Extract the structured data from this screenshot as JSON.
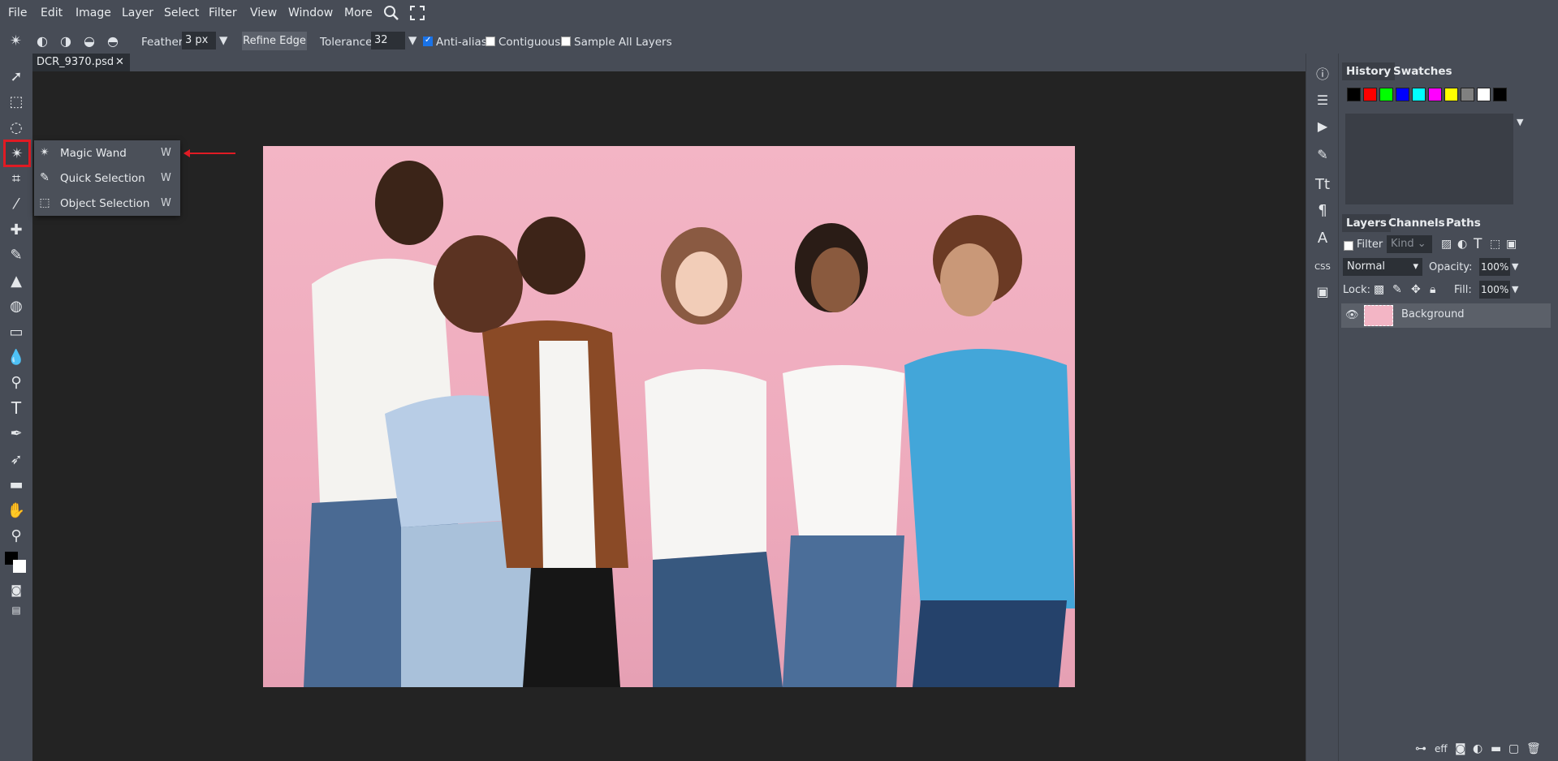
{
  "menu": {
    "items": [
      "File",
      "Edit",
      "Image",
      "Layer",
      "Select",
      "Filter",
      "View",
      "Window",
      "More"
    ]
  },
  "options": {
    "feather_label": "Feather:",
    "feather_value": "3 px",
    "refine_edge": "Refine Edge",
    "tolerance_label": "Tolerance:",
    "tolerance_value": "32",
    "anti_alias": "Anti-alias",
    "contiguous": "Contiguous",
    "sample_all": "Sample All Layers",
    "anti_alias_checked": true,
    "contiguous_checked": false,
    "sample_all_checked": false
  },
  "document": {
    "tab_name": "DCR_9370.psd",
    "close": "✕"
  },
  "flyout": {
    "items": [
      {
        "label": "Magic Wand",
        "key": "W",
        "icon": "magic-wand-icon"
      },
      {
        "label": "Quick Selection",
        "key": "W",
        "icon": "quick-selection-icon"
      },
      {
        "label": "Object Selection",
        "key": "W",
        "icon": "object-selection-icon"
      }
    ]
  },
  "panels": {
    "history_tab": "History",
    "swatches_tab": "Swatches",
    "swatch_colors": [
      "#000000",
      "#ff0000",
      "#00ff00",
      "#0000ff",
      "#00ffff",
      "#ff00ff",
      "#ffff00",
      "#808080",
      "#ffffff",
      "#000000"
    ],
    "layers_tab": "Layers",
    "channels_tab": "Channels",
    "paths_tab": "Paths",
    "filter_label": "Filter",
    "kind_label": "Kind",
    "blend_mode": "Normal",
    "opacity_label": "Opacity:",
    "opacity_value": "100%",
    "lock_label": "Lock:",
    "fill_label": "Fill:",
    "fill_value": "100%",
    "layer_name": "Background",
    "footer_eff": "eff",
    "collapse_left": "> <",
    "expand_rail": "< >",
    "collapse_right": "> <"
  },
  "colors": {
    "accent_red": "#e01b24",
    "ui_bg": "#474c56",
    "canvas_bg": "#232323",
    "photo_bg": "#f3b5c5"
  }
}
